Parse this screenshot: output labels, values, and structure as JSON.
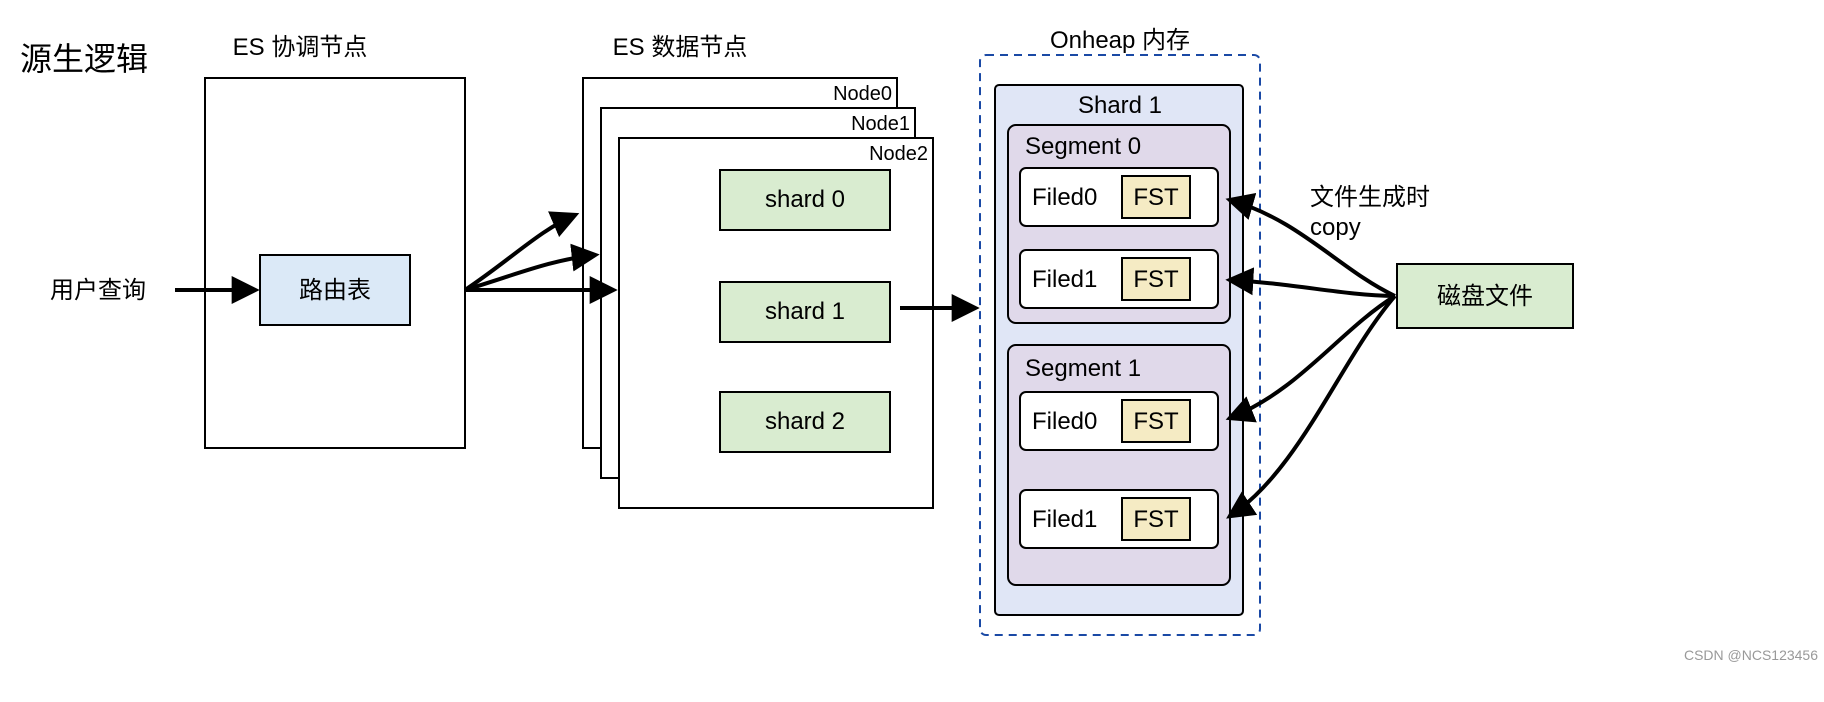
{
  "title": "源生逻辑",
  "coord_node_title": "ES 协调节点",
  "data_node_title": "ES 数据节点",
  "user_query_label": "用户查询",
  "route_table_label": "路由表",
  "nodes": [
    "Node0",
    "Node1",
    "Node2"
  ],
  "shards": [
    "shard 0",
    "shard 1",
    "shard 2"
  ],
  "onheap_title": "Onheap 内存",
  "shard_box_title": "Shard 1",
  "segments": [
    {
      "title": "Segment 0",
      "fields": [
        {
          "name": "Filed0",
          "tag": "FST"
        },
        {
          "name": "Filed1",
          "tag": "FST"
        }
      ]
    },
    {
      "title": "Segment 1",
      "fields": [
        {
          "name": "Filed0",
          "tag": "FST"
        },
        {
          "name": "Filed1",
          "tag": "FST"
        }
      ]
    }
  ],
  "copy_label_line1": "文件生成时",
  "copy_label_line2": "copy",
  "disk_label": "磁盘文件",
  "watermark": "CSDN @NCS123456"
}
